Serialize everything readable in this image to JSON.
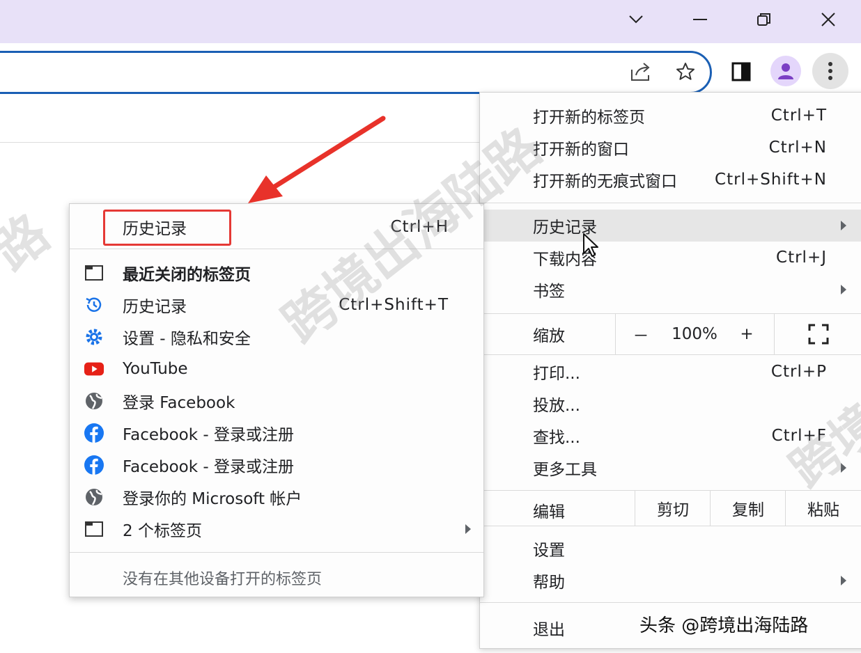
{
  "window": {
    "controls": [
      "chevron-down-icon",
      "restore-icon",
      "close-icon"
    ]
  },
  "toolbar": {
    "icons": [
      "share-icon",
      "star-icon",
      "side-panel-icon",
      "profile-icon",
      "more-menu-icon"
    ]
  },
  "menu": {
    "new_tab": {
      "label": "打开新的标签页",
      "shortcut": "Ctrl+T"
    },
    "new_window": {
      "label": "打开新的窗口",
      "shortcut": "Ctrl+N"
    },
    "incognito": {
      "label": "打开新的无痕式窗口",
      "shortcut": "Ctrl+Shift+N"
    },
    "history": {
      "label": "历史记录"
    },
    "downloads": {
      "label": "下载内容",
      "shortcut": "Ctrl+J"
    },
    "bookmarks": {
      "label": "书签"
    },
    "zoom": {
      "label": "缩放",
      "minus": "－",
      "value": "100%",
      "plus": "+"
    },
    "print": {
      "label": "打印...",
      "shortcut": "Ctrl+P"
    },
    "cast": {
      "label": "投放..."
    },
    "find": {
      "label": "查找...",
      "shortcut": "Ctrl+F"
    },
    "more_tools": {
      "label": "更多工具"
    },
    "edit": {
      "label": "编辑",
      "cut": "剪切",
      "copy": "复制",
      "paste": "粘贴"
    },
    "settings": {
      "label": "设置"
    },
    "help": {
      "label": "帮助"
    },
    "exit": {
      "label": "退出"
    }
  },
  "history_submenu": {
    "header": {
      "label": "历史记录",
      "shortcut": "Ctrl+H"
    },
    "items": [
      {
        "label": "最近关闭的标签页",
        "icon": "tab-icon",
        "bold": true
      },
      {
        "label": "历史记录",
        "shortcut": "Ctrl+Shift+T",
        "icon": "history-icon"
      },
      {
        "label": "设置 - 隐私和安全",
        "icon": "settings-icon"
      },
      {
        "label": "YouTube",
        "icon": "youtube-icon"
      },
      {
        "label": "登录 Facebook",
        "icon": "globe-icon"
      },
      {
        "label": "Facebook - 登录或注册",
        "icon": "facebook-icon"
      },
      {
        "label": "Facebook - 登录或注册",
        "icon": "facebook-icon"
      },
      {
        "label": "登录你的 Microsoft 帐户",
        "icon": "globe-icon"
      },
      {
        "label": "2 个标签页",
        "icon": "tab-icon"
      }
    ],
    "footer": "没有在其他设备打开的标签页"
  },
  "watermark": {
    "text_main": "跨境出海陆路",
    "text_left": "路",
    "text_right": "跨境"
  },
  "caption": "头条 @跨境出海陆路",
  "colors": {
    "titlebar": "#e8e1f8",
    "omnibox_border": "#1a5fb4",
    "highlight_box": "#e53935",
    "annotation_arrow": "#e8322a"
  }
}
